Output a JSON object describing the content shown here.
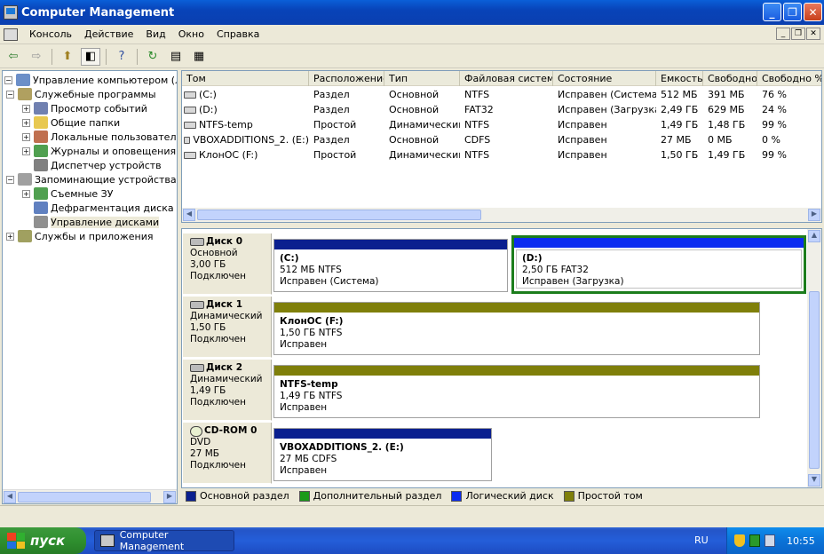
{
  "window": {
    "title": "Computer Management"
  },
  "menu": [
    "Консоль",
    "Действие",
    "Вид",
    "Окно",
    "Справка"
  ],
  "tree": [
    {
      "label": "Управление компьютером (локаль",
      "level": 0,
      "exp": "−",
      "icon": "computer-icon",
      "color": "#6c8fc8"
    },
    {
      "label": "Служебные программы",
      "level": 1,
      "exp": "−",
      "icon": "tools-icon",
      "color": "#b0a060"
    },
    {
      "label": "Просмотр событий",
      "level": 2,
      "exp": "+",
      "icon": "event-viewer-icon",
      "color": "#7080b0"
    },
    {
      "label": "Общие папки",
      "level": 2,
      "exp": "+",
      "icon": "shared-folder-icon",
      "color": "#e8c850"
    },
    {
      "label": "Локальные пользователи и",
      "level": 2,
      "exp": "+",
      "icon": "users-icon",
      "color": "#c07050"
    },
    {
      "label": "Журналы и оповещения пр",
      "level": 2,
      "exp": "+",
      "icon": "performance-log-icon",
      "color": "#50a050"
    },
    {
      "label": "Диспетчер устройств",
      "level": 2,
      "exp": "",
      "icon": "device-manager-icon",
      "color": "#808080"
    },
    {
      "label": "Запоминающие устройства",
      "level": 1,
      "exp": "−",
      "icon": "storage-icon",
      "color": "#a0a0a0"
    },
    {
      "label": "Съемные ЗУ",
      "level": 2,
      "exp": "+",
      "icon": "removable-storage-icon",
      "color": "#50a050"
    },
    {
      "label": "Дефрагментация диска",
      "level": 2,
      "exp": "",
      "icon": "defrag-icon",
      "color": "#6080c0"
    },
    {
      "label": "Управление дисками",
      "level": 2,
      "exp": "",
      "icon": "disk-management-icon",
      "color": "#909090",
      "selected": true
    },
    {
      "label": "Службы и приложения",
      "level": 1,
      "exp": "+",
      "icon": "services-icon",
      "color": "#a0a060"
    }
  ],
  "volumes": {
    "columns": [
      "Том",
      "Расположение",
      "Тип",
      "Файловая система",
      "Состояние",
      "Емкость",
      "Свободно",
      "Свободно %"
    ],
    "rows": [
      [
        "(C:)",
        "Раздел",
        "Основной",
        "NTFS",
        "Исправен (Система)",
        "512 МБ",
        "391 МБ",
        "76 %"
      ],
      [
        "(D:)",
        "Раздел",
        "Основной",
        "FAT32",
        "Исправен (Загрузка)",
        "2,49 ГБ",
        "629 МБ",
        "24 %"
      ],
      [
        "NTFS-temp",
        "Простой",
        "Динамический",
        "NTFS",
        "Исправен",
        "1,49 ГБ",
        "1,48 ГБ",
        "99 %"
      ],
      [
        "VBOXADDITIONS_2. (E:)",
        "Раздел",
        "Основной",
        "CDFS",
        "Исправен",
        "27 МБ",
        "0 МБ",
        "0 %"
      ],
      [
        "КлонОС (F:)",
        "Простой",
        "Динамический",
        "NTFS",
        "Исправен",
        "1,50 ГБ",
        "1,49 ГБ",
        "99 %"
      ]
    ]
  },
  "disks": [
    {
      "name": "Диск 0",
      "type": "Основной",
      "size": "3,00 ГБ",
      "status": "Подключен",
      "icon": "hard-disk-icon",
      "partitions": [
        {
          "name": "(C:)",
          "size": "512 МБ NTFS",
          "state": "Исправен (Система)",
          "color": "#0a1f8f"
        },
        {
          "name": "(D:)",
          "size": "2,50 ГБ FAT32",
          "state": "Исправен (Загрузка)",
          "color": "#0b2bf0",
          "selected": true
        }
      ]
    },
    {
      "name": "Диск 1",
      "type": "Динамический",
      "size": "1,50 ГБ",
      "status": "Подключен",
      "icon": "hard-disk-icon",
      "partitions": [
        {
          "name": "КлонОС  (F:)",
          "size": "1,50 ГБ NTFS",
          "state": "Исправен",
          "color": "#7f7f0a"
        }
      ]
    },
    {
      "name": "Диск 2",
      "type": "Динамический",
      "size": "1,49 ГБ",
      "status": "Подключен",
      "icon": "hard-disk-icon",
      "partitions": [
        {
          "name": "NTFS-temp",
          "size": "1,49 ГБ NTFS",
          "state": "Исправен",
          "color": "#7f7f0a"
        }
      ]
    },
    {
      "name": "CD-ROM 0",
      "type": "DVD",
      "size": "27 МБ",
      "status": "Подключен",
      "icon": "cdrom-icon",
      "partitions": [
        {
          "name": "VBOXADDITIONS_2.  (E:)",
          "size": "27 МБ CDFS",
          "state": "Исправен",
          "color": "#0a1f8f"
        }
      ]
    }
  ],
  "legend": [
    {
      "label": "Основной раздел",
      "color": "#0a1f8f"
    },
    {
      "label": "Дополнительный раздел",
      "color": "#1a9a1a"
    },
    {
      "label": "Логический диск",
      "color": "#0b2bf0"
    },
    {
      "label": "Простой том",
      "color": "#7f7f0a"
    }
  ],
  "taskbar": {
    "start": "пуск",
    "task": "Computer Management",
    "lang": "RU",
    "clock": "10:55"
  }
}
